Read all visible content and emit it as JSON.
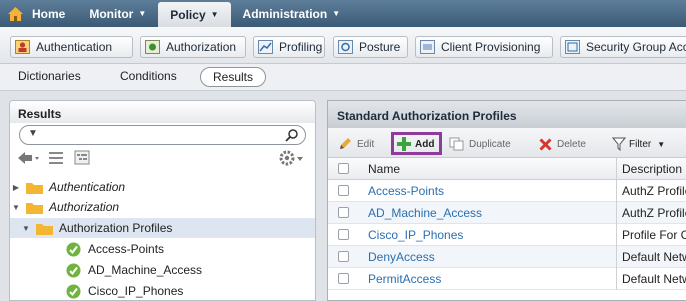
{
  "topnav": {
    "home": "Home",
    "monitor": "Monitor",
    "policy": "Policy",
    "administration": "Administration",
    "caret": "▼"
  },
  "subtabs": [
    {
      "label": "Authentication",
      "icon": "authentication-icon"
    },
    {
      "label": "Authorization",
      "icon": "authorization-icon"
    },
    {
      "label": "Profiling",
      "icon": "profiling-icon"
    },
    {
      "label": "Posture",
      "icon": "posture-icon"
    },
    {
      "label": "Client Provisioning",
      "icon": "client-provisioning-icon"
    },
    {
      "label": "Security Group Acc",
      "icon": "security-group-icon"
    }
  ],
  "thirdbar": {
    "dictionaries": "Dictionaries",
    "conditions": "Conditions",
    "results": "Results"
  },
  "left": {
    "title": "Results",
    "search_caret": "▼",
    "tree": [
      {
        "label": "Authentication",
        "italic": true,
        "expanded": false
      },
      {
        "label": "Authorization",
        "italic": true,
        "expanded": true
      },
      {
        "label": "Authorization Profiles",
        "italic": false,
        "expanded": true
      },
      {
        "label": "Access-Points"
      },
      {
        "label": "AD_Machine_Access"
      },
      {
        "label": "Cisco_IP_Phones"
      }
    ]
  },
  "right": {
    "title": "Standard Authorization Profiles",
    "toolbar": {
      "edit": "Edit",
      "add": "Add",
      "duplicate": "Duplicate",
      "delete": "Delete",
      "filter": "Filter"
    },
    "columns": {
      "name": "Name",
      "description": "Description"
    },
    "rows": [
      {
        "name": "Access-Points",
        "description": "AuthZ Profile"
      },
      {
        "name": "AD_Machine_Access",
        "description": "AuthZ Profile"
      },
      {
        "name": "Cisco_IP_Phones",
        "description": "Profile For C"
      },
      {
        "name": "DenyAccess",
        "description": "Default Netw"
      },
      {
        "name": "PermitAccess",
        "description": "Default Netw"
      }
    ]
  },
  "colors": {
    "nav_dark": "#3b5a75",
    "link_blue": "#2a6fb0",
    "highlight_purple": "#8e3c9b",
    "add_green": "#3aa63a",
    "delete_red": "#d9362b"
  }
}
